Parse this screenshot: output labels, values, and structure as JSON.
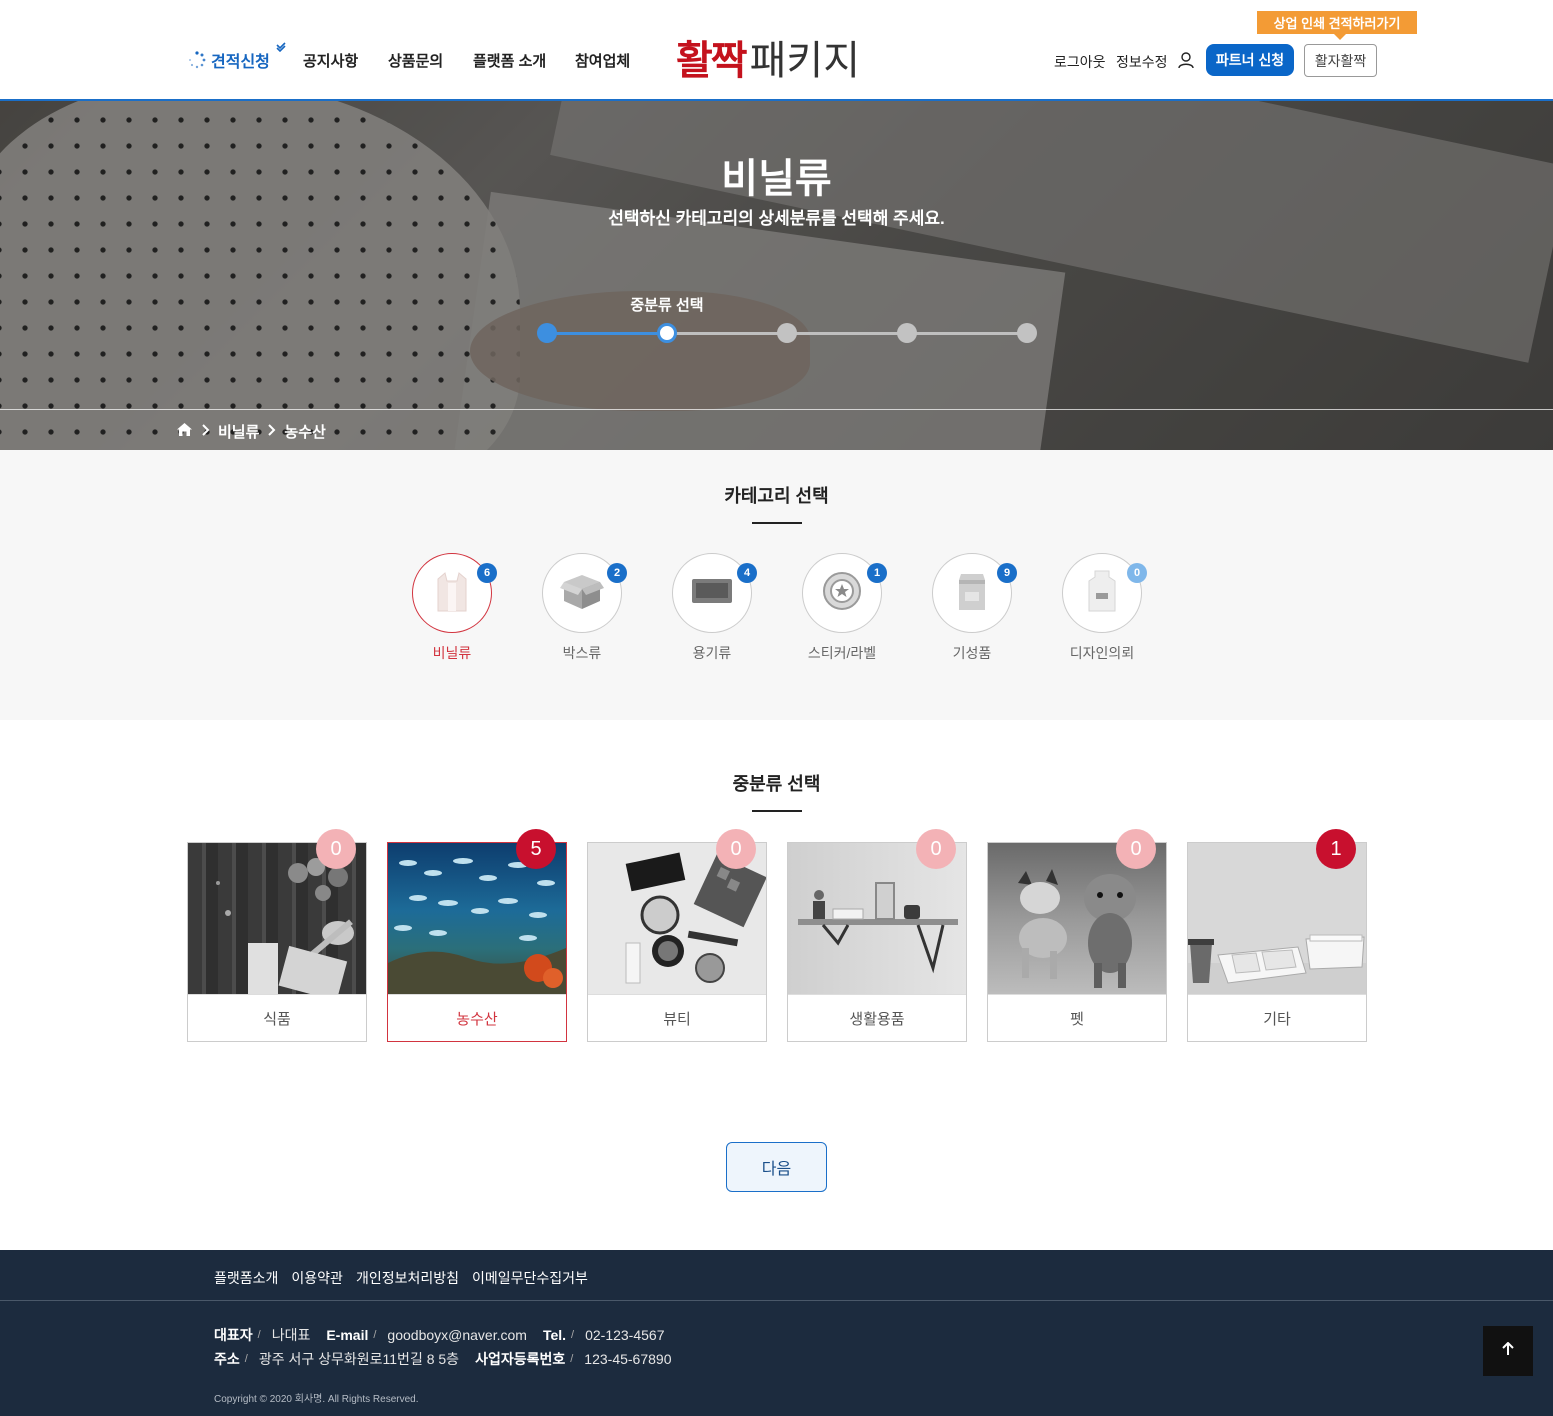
{
  "header": {
    "apply_label": "견적신청",
    "nav": [
      "공지사항",
      "상품문의",
      "플랫폼 소개",
      "참여업체"
    ],
    "logo_part1": "활짝",
    "logo_part2": "패키지",
    "logout": "로그아웃",
    "edit_info": "정보수정",
    "partner_button": "파트너 신청",
    "hwal_button": "활자활짝",
    "promo": "상업 인쇄 견적하러가기"
  },
  "hero": {
    "title": "비닐류",
    "subtitle": "선택하신 카테고리의 상세분류를 선택해 주세요.",
    "step_label": "중분류 선택",
    "step_total": 5,
    "step_current": 2,
    "breadcrumb": [
      "비닐류",
      "농수산"
    ]
  },
  "category": {
    "title": "카테고리 선택",
    "items": [
      {
        "label": "비닐류",
        "count": "6",
        "active": true,
        "icon": "vinyl-bag-icon"
      },
      {
        "label": "박스류",
        "count": "2",
        "active": false,
        "icon": "box-icon"
      },
      {
        "label": "용기류",
        "count": "4",
        "active": false,
        "icon": "container-icon"
      },
      {
        "label": "스티커/라벨",
        "count": "1",
        "active": false,
        "icon": "sticker-icon"
      },
      {
        "label": "기성품",
        "count": "9",
        "active": false,
        "icon": "ready-made-icon"
      },
      {
        "label": "디자인의뢰",
        "count": "0",
        "active": false,
        "icon": "design-request-icon"
      }
    ]
  },
  "subcategory": {
    "title": "중분류 선택",
    "items": [
      {
        "label": "식품",
        "count": "0",
        "active": false
      },
      {
        "label": "농수산",
        "count": "5",
        "active": true
      },
      {
        "label": "뷰티",
        "count": "0",
        "active": false
      },
      {
        "label": "생활용품",
        "count": "0",
        "active": false
      },
      {
        "label": "펫",
        "count": "0",
        "active": false
      },
      {
        "label": "기타",
        "count": "1",
        "active": false
      }
    ]
  },
  "next_button": "다음",
  "footer": {
    "links": [
      "플랫폼소개",
      "이용약관",
      "개인정보처리방침",
      "이메일무단수집거부"
    ],
    "ceo_label": "대표자",
    "ceo": "나대표",
    "email_label": "E-mail",
    "email": "goodboyx@naver.com",
    "tel_label": "Tel.",
    "tel": "02-123-4567",
    "addr_label": "주소",
    "addr": "광주 서구 상무화원로11번길 8 5층",
    "biz_label": "사업자등록번호",
    "biz": "123-45-67890",
    "copyright": "Copyright © 2020 회사명. All Rights Reserved."
  },
  "colors": {
    "brand_blue": "#0a66c8",
    "brand_red": "#c8102e",
    "promo_orange": "#f39b35",
    "footer_bg": "#1c2b3e"
  }
}
